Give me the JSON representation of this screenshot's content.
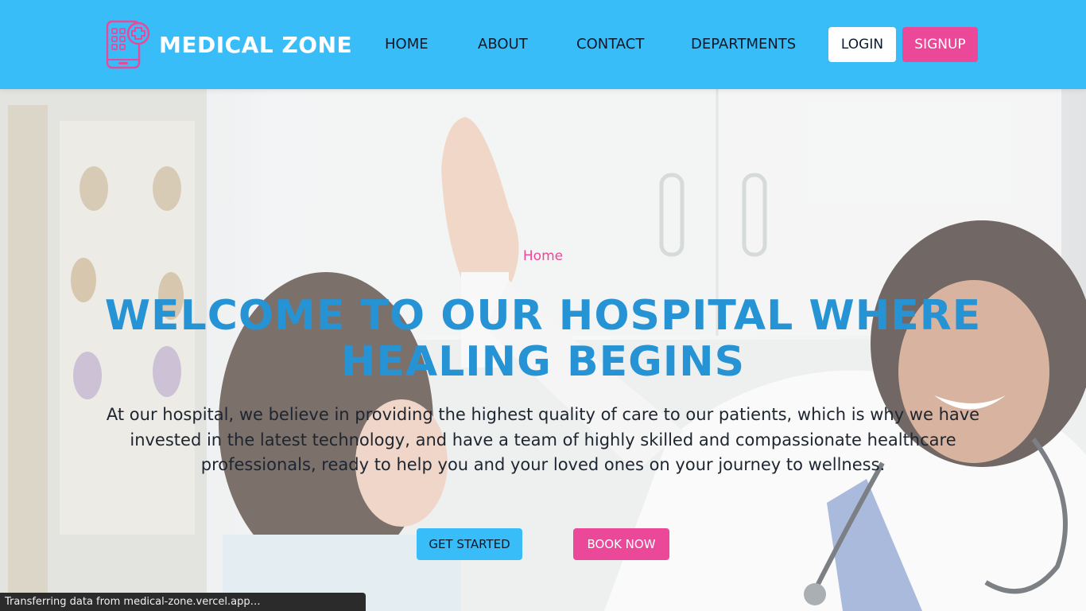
{
  "brand": {
    "name": "MEDICAL ZONE",
    "icon": "medical-phone-icon"
  },
  "nav": {
    "links": [
      {
        "label": "HOME"
      },
      {
        "label": "ABOUT"
      },
      {
        "label": "CONTACT"
      },
      {
        "label": "DEPARTMENTS"
      }
    ],
    "login_label": "LOGIN",
    "signup_label": "SIGNUP"
  },
  "hero": {
    "breadcrumb": "Home",
    "title": "WELCOME TO OUR HOSPITAL WHERE HEALING BEGINS",
    "description": "At our hospital, we believe in providing the highest quality of care to our patients, which is why we have invested in the latest technology, and have a team of highly skilled and compassionate healthcare professionals, ready to help you and your loved ones on your journey to wellness.",
    "get_started_label": "GET STARTED",
    "book_now_label": "BOOK NOW"
  },
  "status": {
    "text": "Transferring data from medical-zone.vercel.app…"
  },
  "colors": {
    "navbar": "#38bdf8",
    "accent_pink": "#ec4899",
    "title_blue": "#2593d4",
    "text_dark": "#1d2530"
  }
}
